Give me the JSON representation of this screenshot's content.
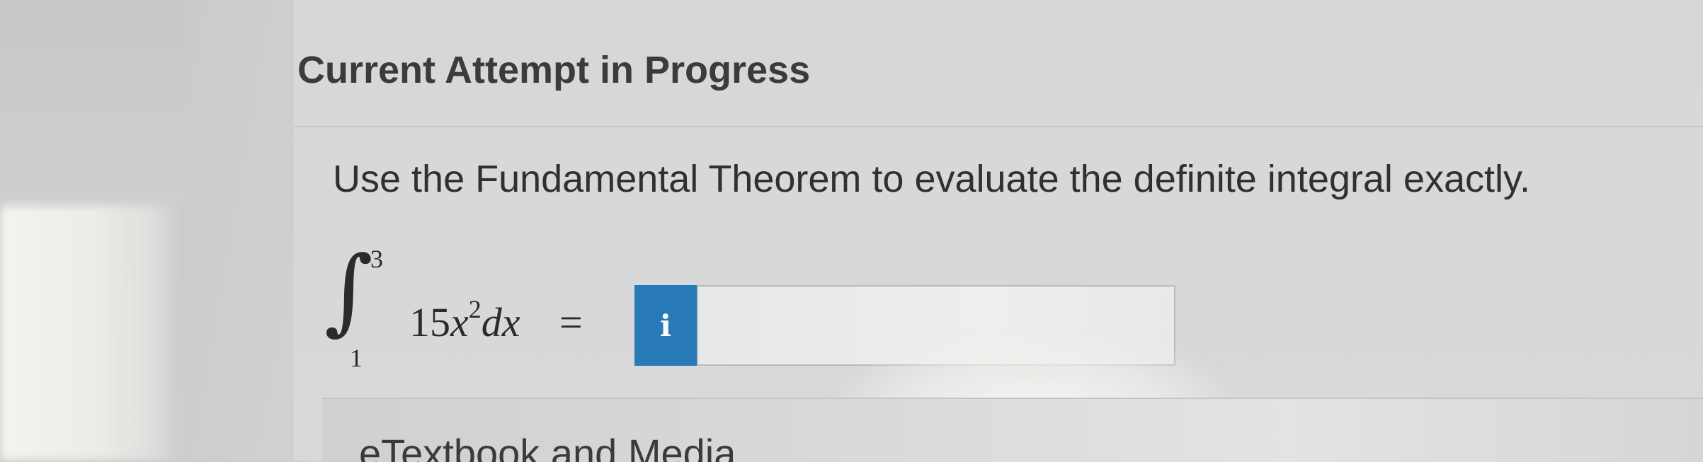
{
  "header": {
    "title": "Current Attempt in Progress"
  },
  "question": {
    "prompt": "Use the Fundamental Theorem to evaluate the definite integral exactly.",
    "integral": {
      "upper_limit": "3",
      "lower_limit": "1",
      "coefficient": "15",
      "variable": "x",
      "exponent": "2",
      "differential": "dx",
      "equals": "="
    }
  },
  "answer": {
    "info_icon": "info-icon",
    "info_glyph": "i",
    "value": "",
    "placeholder": ""
  },
  "resources": {
    "label": "eTextbook and Media"
  }
}
